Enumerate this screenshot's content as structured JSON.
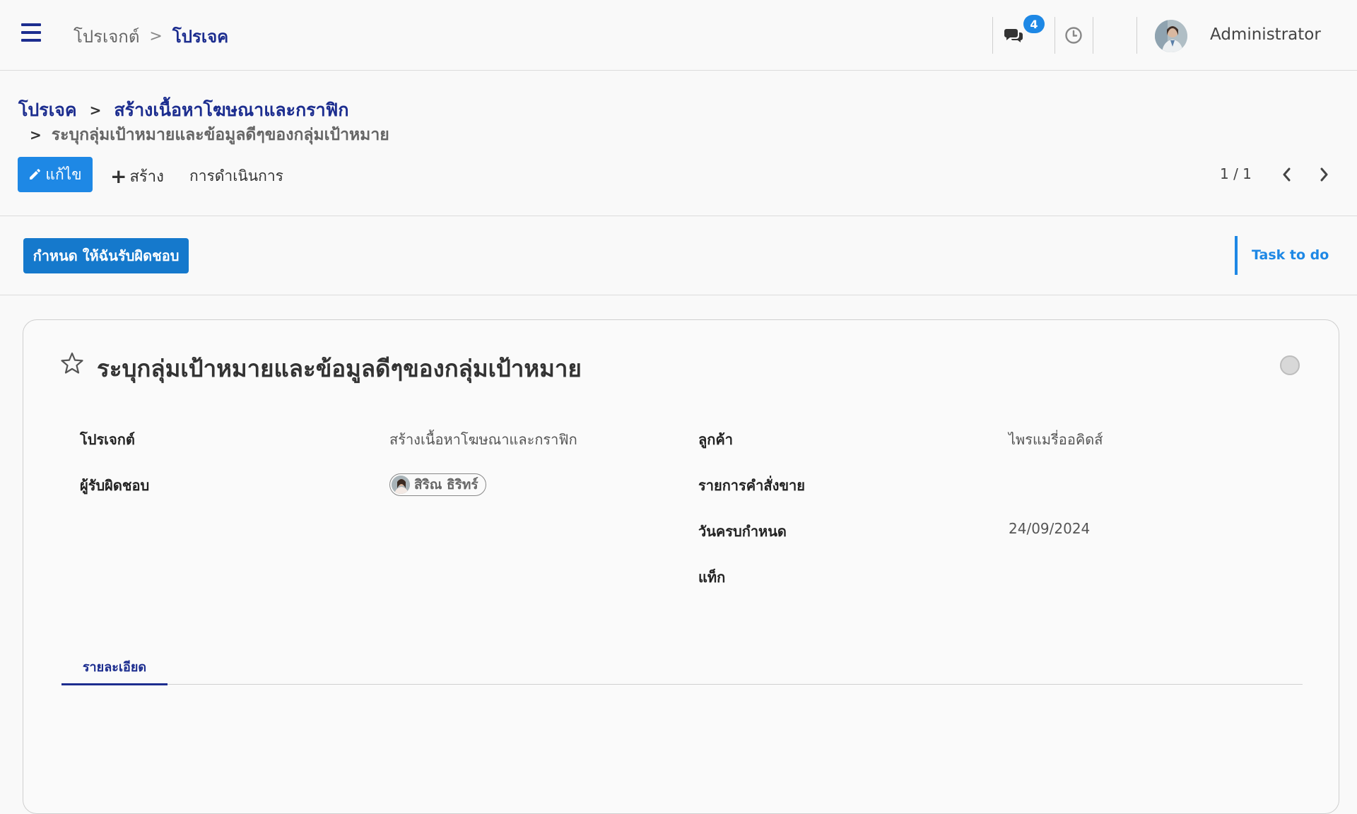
{
  "topbar": {
    "breadcrumb_root": "โปรเจกต์",
    "breadcrumb_sep": ">",
    "breadcrumb_current": "โปรเจค",
    "message_count": "4",
    "username": "Administrator"
  },
  "breadcrumb": {
    "item1": "โปรเจค",
    "sep": ">",
    "item2": "สร้างเนื้อหาโฆษณาและกราฟิก",
    "item3": "ระบุกลุ่มเป้าหมายและข้อมูลดีๆของกลุ่มเป้าหมาย"
  },
  "toolbar": {
    "edit_label": "แก้ไข",
    "create_label": "สร้าง",
    "actions_label": "การดำเนินการ",
    "pager": "1 / 1"
  },
  "statusbar": {
    "assign_label": "กำหนด ให้ฉันรับผิดชอบ",
    "stage_label": "Task to do"
  },
  "task": {
    "title": "ระบุกลุ่มเป้าหมายและข้อมูลดีๆของกลุ่มเป้าหมาย",
    "fields": {
      "project_label": "โปรเจกต์",
      "project_value": "สร้างเนื้อหาโฆษณาและกราฟิก",
      "assignee_label": "ผู้รับผิดชอบ",
      "assignee_value": "สิริณ ธิริทร์",
      "customer_label": "ลูกค้า",
      "customer_value": "ไพรแมรี่ออคิดส์",
      "sale_order_label": "รายการคำสั่งขาย",
      "deadline_label": "วันครบกำหนด",
      "deadline_value": "24/09/2024",
      "tags_label": "แท็ก"
    },
    "tabs": [
      {
        "label": "รายละเอียด"
      }
    ]
  },
  "colors": {
    "primary": "#1e88e5",
    "navy": "#1c2d8f"
  }
}
